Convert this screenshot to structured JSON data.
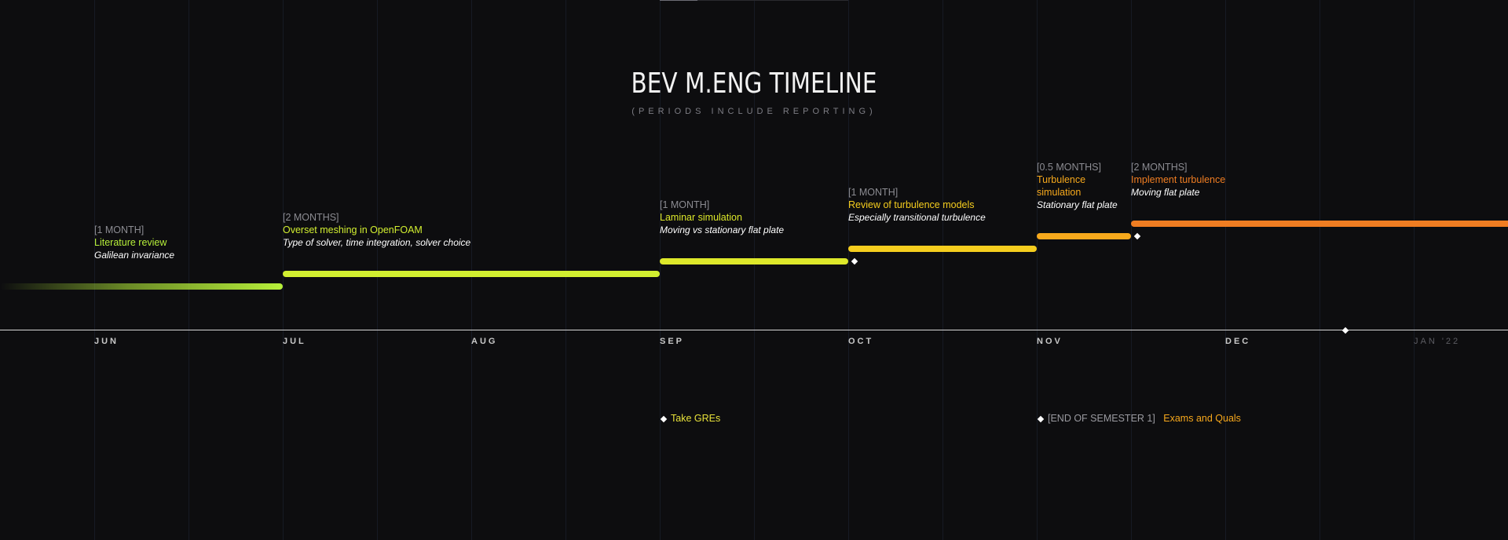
{
  "title": "BEV M.ENG TIMELINE",
  "subtitle": "(PERIODS INCLUDE REPORTING)",
  "months": [
    "JUN",
    "JUL",
    "AUG",
    "SEP",
    "OCT",
    "NOV",
    "DEC",
    "JAN '22"
  ],
  "tasks": [
    {
      "duration": "[1 MONTH]",
      "name": "Literature review",
      "note": "Galilean invariance",
      "color": "#b7f03a"
    },
    {
      "duration": "[2 MONTHS]",
      "name": "Overset meshing in OpenFOAM",
      "note": "Type of solver, time integration, solver choice",
      "color": "#d2ef30"
    },
    {
      "duration": "[1 MONTH]",
      "name": "Laminar simulation",
      "note": "Moving vs stationary flat plate",
      "color": "#dde82a"
    },
    {
      "duration": "[1 MONTH]",
      "name": "Review of turbulence models",
      "note": "Especially transitional turbulence",
      "color": "#f5cd1e"
    },
    {
      "duration": "[0.5 MONTHS]",
      "name": "Turbulence simulation",
      "note": "Stationary flat plate",
      "color": "#f7a91c"
    },
    {
      "duration": "[2 MONTHS]",
      "name": "Implement turbulence",
      "note": "Moving flat plate",
      "color": "#ef7d22"
    }
  ],
  "events": [
    {
      "tag": "",
      "label": "Take GREs",
      "color": "#e8e23a"
    },
    {
      "tag": "[END OF SEMESTER 1]",
      "label": "Exams and Quals",
      "color": "#f7a81c"
    }
  ],
  "icons": [
    "diamond-icon"
  ]
}
